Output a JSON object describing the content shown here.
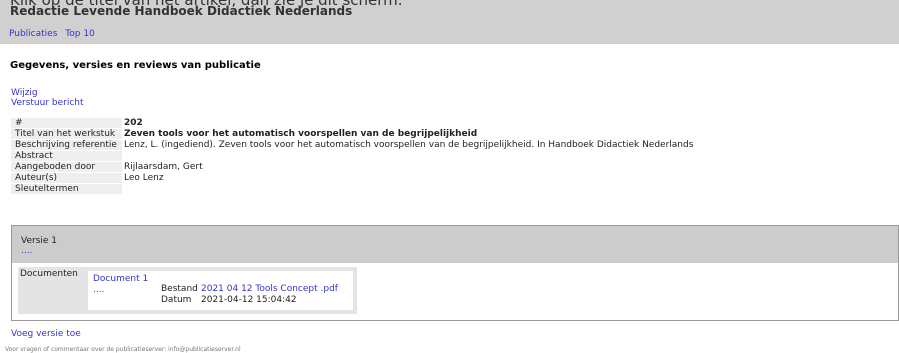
{
  "instruction": "Klik op de titel van het artikel, dan zie je dit scherm.",
  "header": {
    "site_title": "Redactie Levende Handboek Didactiek Nederlands",
    "nav": [
      "Publicaties",
      "Top 10"
    ]
  },
  "page_title": "Gegevens, versies en reviews van publicatie",
  "actions": [
    "Wijzig",
    "Verstuur bericht"
  ],
  "details": [
    {
      "label": "#",
      "value": "202"
    },
    {
      "label": "Titel van het werkstuk",
      "value": "Zeven tools voor het automatisch voorspellen van de begrijpelijkheid"
    },
    {
      "label": "Beschrijving referentie",
      "value": "Lenz, L. (ingediend). Zeven tools voor het automatisch voorspellen van de begrijpelijkheid. In Handboek Didactiek Nederlands"
    },
    {
      "label": "Abstract",
      "value": ""
    },
    {
      "label": "Aangeboden door",
      "value": "Rijlaarsdam, Gert"
    },
    {
      "label": "Auteur(s)",
      "value": "Leo Lenz"
    },
    {
      "label": "Sleuteltermen",
      "value": ""
    }
  ],
  "version": {
    "title": "Versie 1",
    "dots": "....",
    "documents_label": "Documenten",
    "document": {
      "name": "Document 1",
      "dots": "....",
      "file_label": "Bestand",
      "file_value": "2021 04 12 Tools Concept .pdf",
      "date_label": "Datum",
      "date_value": "2021-04-12 15:04:42"
    }
  },
  "add_version": "Voeg versie toe",
  "footer": "Voor vragen of commentaar over de publicatieserver: info@publicatieserver.nl"
}
